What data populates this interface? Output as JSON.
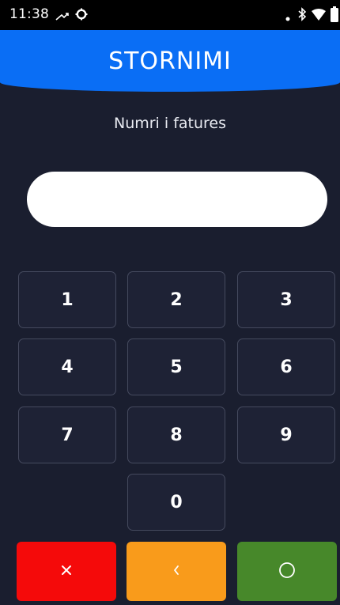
{
  "status_bar": {
    "time": "11:38",
    "icons": [
      "missed-call-icon",
      "settings-icon",
      "dot-icon",
      "bluetooth-icon",
      "wifi-icon",
      "battery-icon"
    ]
  },
  "header": {
    "title": "STORNIMI",
    "background_color": "#0a6ef5"
  },
  "prompt": {
    "label": "Numri i fatures"
  },
  "invoice_input": {
    "value": "",
    "placeholder": ""
  },
  "keypad": {
    "keys": [
      "1",
      "2",
      "3",
      "4",
      "5",
      "6",
      "7",
      "8",
      "9",
      "0"
    ]
  },
  "actions": {
    "cancel": {
      "icon": "close-icon",
      "glyph": "×",
      "color": "#f50a0a"
    },
    "back": {
      "icon": "chevron-left-icon",
      "glyph": "‹",
      "color": "#f99b1b"
    },
    "ok": {
      "icon": "circle-icon",
      "glyph": "○",
      "color": "#47882a"
    }
  },
  "colors": {
    "background": "#1a1e2f",
    "key_background": "#1e2235",
    "key_border": "#454a5e"
  }
}
